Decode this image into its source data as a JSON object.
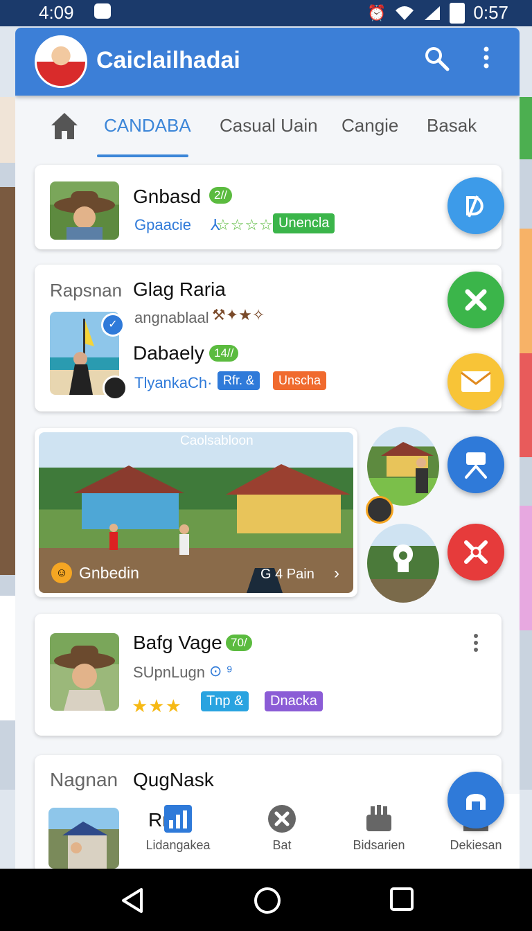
{
  "status_bar": {
    "time_left": "4:09",
    "time_right": "0:57"
  },
  "app_bar": {
    "title": "Caiclailhadai"
  },
  "tabs": [
    {
      "label": "CANDABA",
      "active": true
    },
    {
      "label": "Casual Uain",
      "active": false
    },
    {
      "label": "Cangie",
      "active": false
    },
    {
      "label": "Basak",
      "active": false
    }
  ],
  "card1": {
    "name": "Gnbasd",
    "badge": "2//",
    "subtitle": "Gpaacie",
    "rating_glyphs": "☆☆☆☆",
    "tag": "Unencla"
  },
  "card2": {
    "label": "Rapsnan",
    "name": "Glag Raria",
    "subtitle": "angnablaal",
    "name2": "Dabaely",
    "badge": "14//",
    "subtitle2": "TlyankaCh·",
    "tag1": "Rfr. &",
    "tag2": "Unscha"
  },
  "photo_card": {
    "caption": "Caolsabloon",
    "label": "Gnbedin",
    "pager": "G 4 Pain"
  },
  "card3": {
    "name": "Bafg Vage",
    "badge": "70/",
    "subtitle": "SUpnLugn",
    "rating_glyphs": "★★★",
    "tag1": "Tnp &",
    "tag2": "Dnacka"
  },
  "card4": {
    "label": "Nagnan",
    "name": "QugNask",
    "partial_name": "Rn"
  },
  "bottom_nav": [
    {
      "label": "Lidangakea",
      "icon": "bar-chart-icon"
    },
    {
      "label": "Bat",
      "icon": "close-circle-icon"
    },
    {
      "label": "Bidsarien",
      "icon": "briefcase-icon"
    },
    {
      "label": "Dekiesan",
      "icon": "inbox-icon"
    }
  ],
  "colors": {
    "app_bar": "#3c7fd7",
    "accent": "#3c86d8",
    "fab_blue_light": "#3d9be9",
    "fab_green": "#3bb54a",
    "fab_yellow": "#f8c437",
    "fab_blue": "#2f7ad9",
    "fab_red": "#e63b3b",
    "fab_home": "#2f7ad9",
    "tag_green": "#3bb54a",
    "tag_blue": "#2f7ad9",
    "tag_orange": "#f06a2e",
    "tag_cyan": "#29a3e0",
    "tag_purple": "#8b5cd6"
  }
}
